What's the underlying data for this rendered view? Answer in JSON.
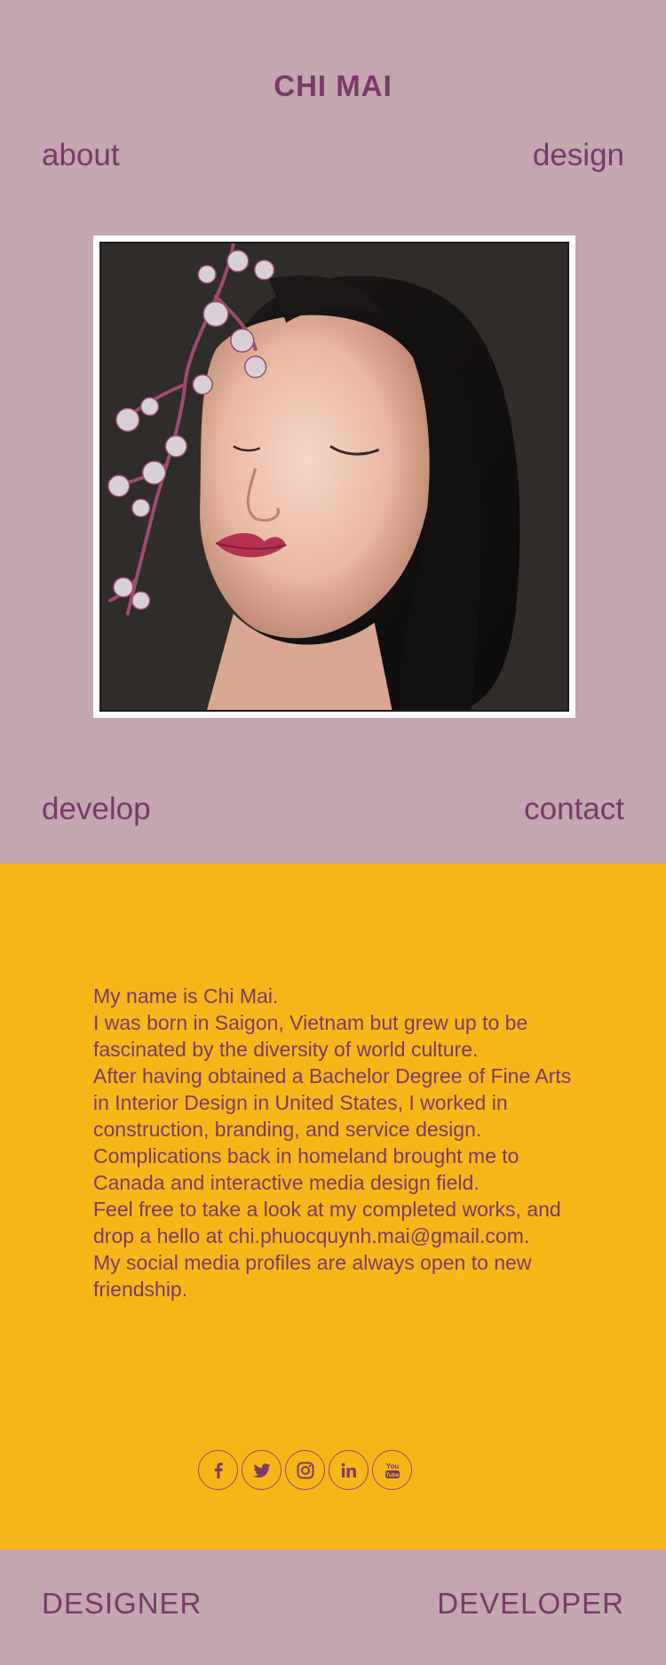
{
  "header": {
    "title": "CHI MAI"
  },
  "nav": {
    "about": "about",
    "design": "design",
    "develop": "develop",
    "contact": "contact"
  },
  "about": {
    "paragraphs": [
      "My name is Chi Mai.",
      "I was born in Saigon, Vietnam but grew up to be fascinated by the diversity of world culture.",
      "After having obtained a Bachelor Degree of Fine Arts in Interior Design in United States, I worked in construction, branding, and service design.",
      "Complications back in homeland brought me to Canada and interactive media design field.",
      "Feel free to take a look at my completed works, and drop a hello at chi.phuocquynh.mai@gmail.com.",
      "My social media profiles are always open to new friendship."
    ]
  },
  "social": {
    "icons": [
      "facebook-icon",
      "twitter-icon",
      "instagram-icon",
      "linkedin-icon",
      "youtube-icon"
    ],
    "youtube_text_1": "You",
    "youtube_text_2": "Tube"
  },
  "footer": {
    "left": "DESIGNER",
    "right": "DEVELOPER"
  },
  "colors": {
    "background_mauve": "#c4a5b0",
    "accent_yellow": "#f7b718",
    "text_purple": "#7a3a6a"
  }
}
